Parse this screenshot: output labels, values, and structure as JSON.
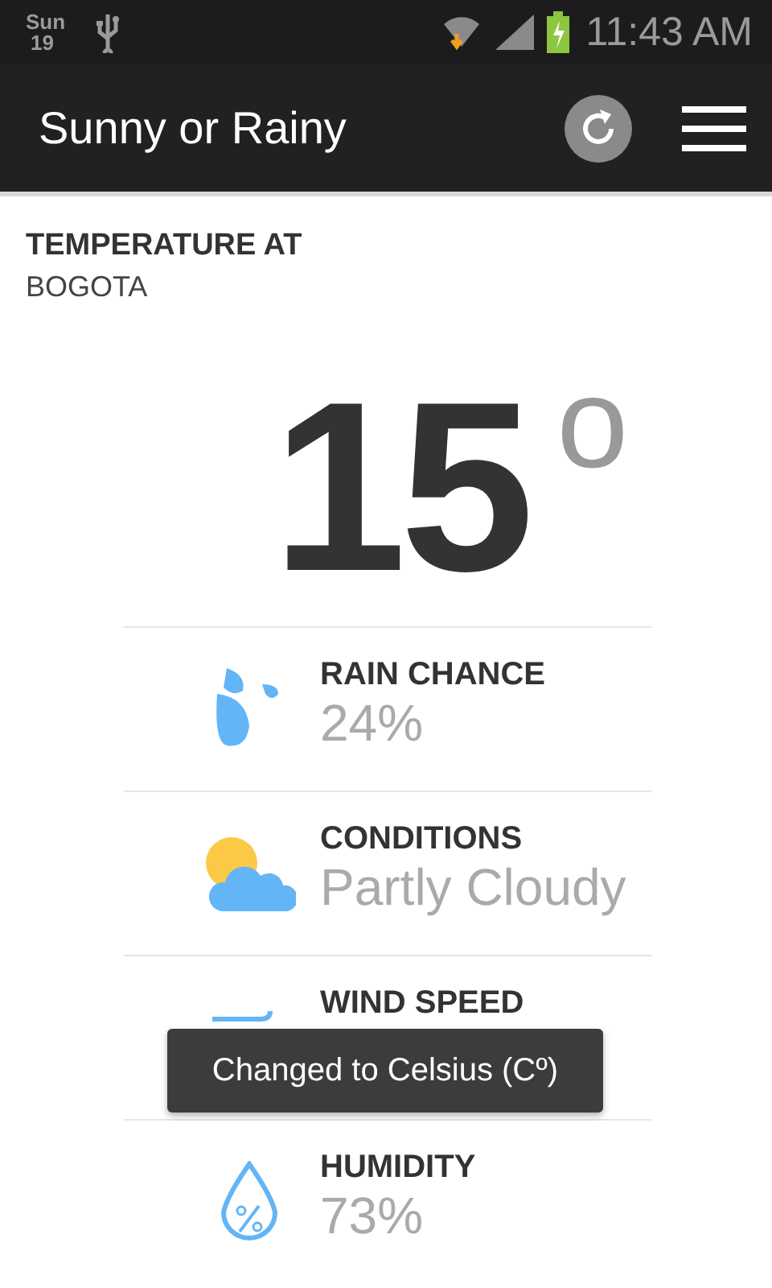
{
  "status_bar": {
    "day": "Sun",
    "date": "19",
    "time": "11:43 AM"
  },
  "app_bar": {
    "title": "Sunny or Rainy"
  },
  "location": {
    "heading": "TEMPERATURE AT",
    "city": "BOGOTA"
  },
  "temperature": {
    "value": "15",
    "unit": "o"
  },
  "metrics": [
    {
      "kind": "rain",
      "label": "RAIN CHANCE",
      "value": "24%"
    },
    {
      "kind": "conditions",
      "label": "CONDITIONS",
      "value": "Partly Cloudy"
    },
    {
      "kind": "wind",
      "label": "WIND SPEED"
    },
    {
      "kind": "humidity",
      "label": "HUMIDITY",
      "value": "73%"
    }
  ],
  "toast": {
    "message": "Changed to Celsius (Cº)"
  }
}
